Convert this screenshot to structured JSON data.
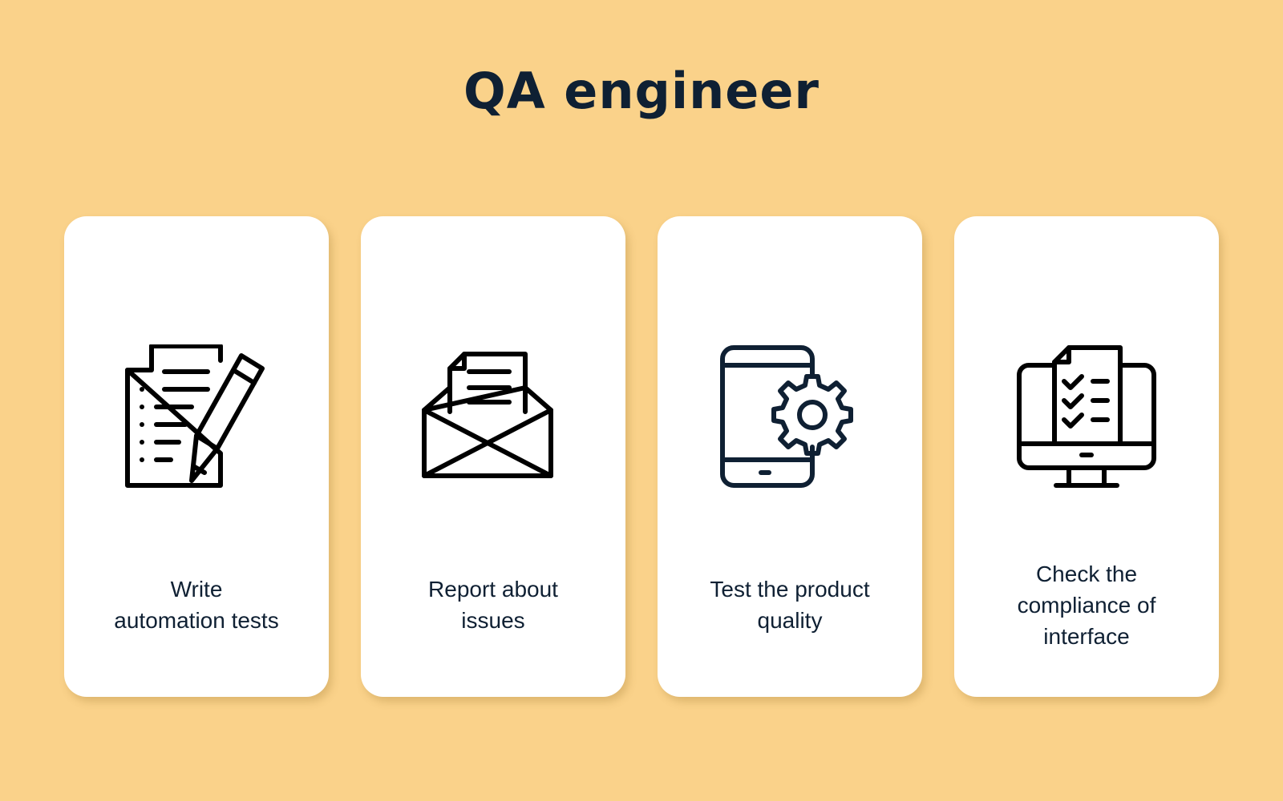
{
  "title": "QA engineer",
  "colors": {
    "background": "#FAD28A",
    "card": "#FFFFFF",
    "text": "#0F2033",
    "icon": "#000000"
  },
  "cards": [
    {
      "icon": "document-pencil-icon",
      "label": "Write\nautomation tests"
    },
    {
      "icon": "open-envelope-letter-icon",
      "label": "Report about\nissues"
    },
    {
      "icon": "tablet-gear-icon",
      "label": "Test the product\nquality"
    },
    {
      "icon": "monitor-checklist-icon",
      "label": "Check the\ncompliance of\ninterface"
    }
  ]
}
